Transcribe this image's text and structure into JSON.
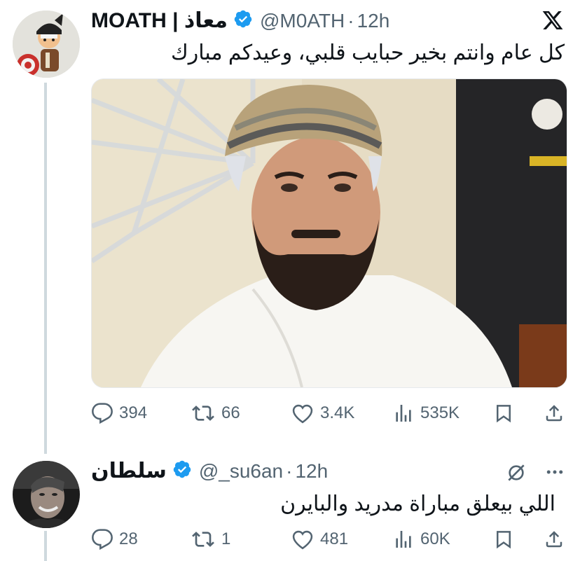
{
  "tweet1": {
    "display_name": "MOATH | معاذ",
    "handle": "@M0ATH",
    "separator": "·",
    "time": "12h",
    "text": "كل عام وانتم بخير حبايب قلبي، وعيدكم مبارك",
    "replies": "394",
    "reposts": "66",
    "likes": "3.4K",
    "views": "535K"
  },
  "tweet2": {
    "display_name": "سلطان",
    "handle": "@_su6an",
    "separator": "·",
    "time": "12h",
    "text": "اللي بيعلق مباراة مدريد والبايرن",
    "replies": "28",
    "reposts": "1",
    "likes": "481",
    "views": "60K"
  },
  "colors": {
    "verified": "#1d9bf0",
    "muted": "#536471",
    "thread_line": "#cfd9de",
    "text": "#0f1419"
  },
  "icons": [
    "x-logo-icon",
    "verified-badge-icon",
    "reply-icon",
    "repost-icon",
    "like-icon",
    "views-icon",
    "bookmark-icon",
    "share-icon",
    "hidden-icon",
    "more-icon"
  ]
}
